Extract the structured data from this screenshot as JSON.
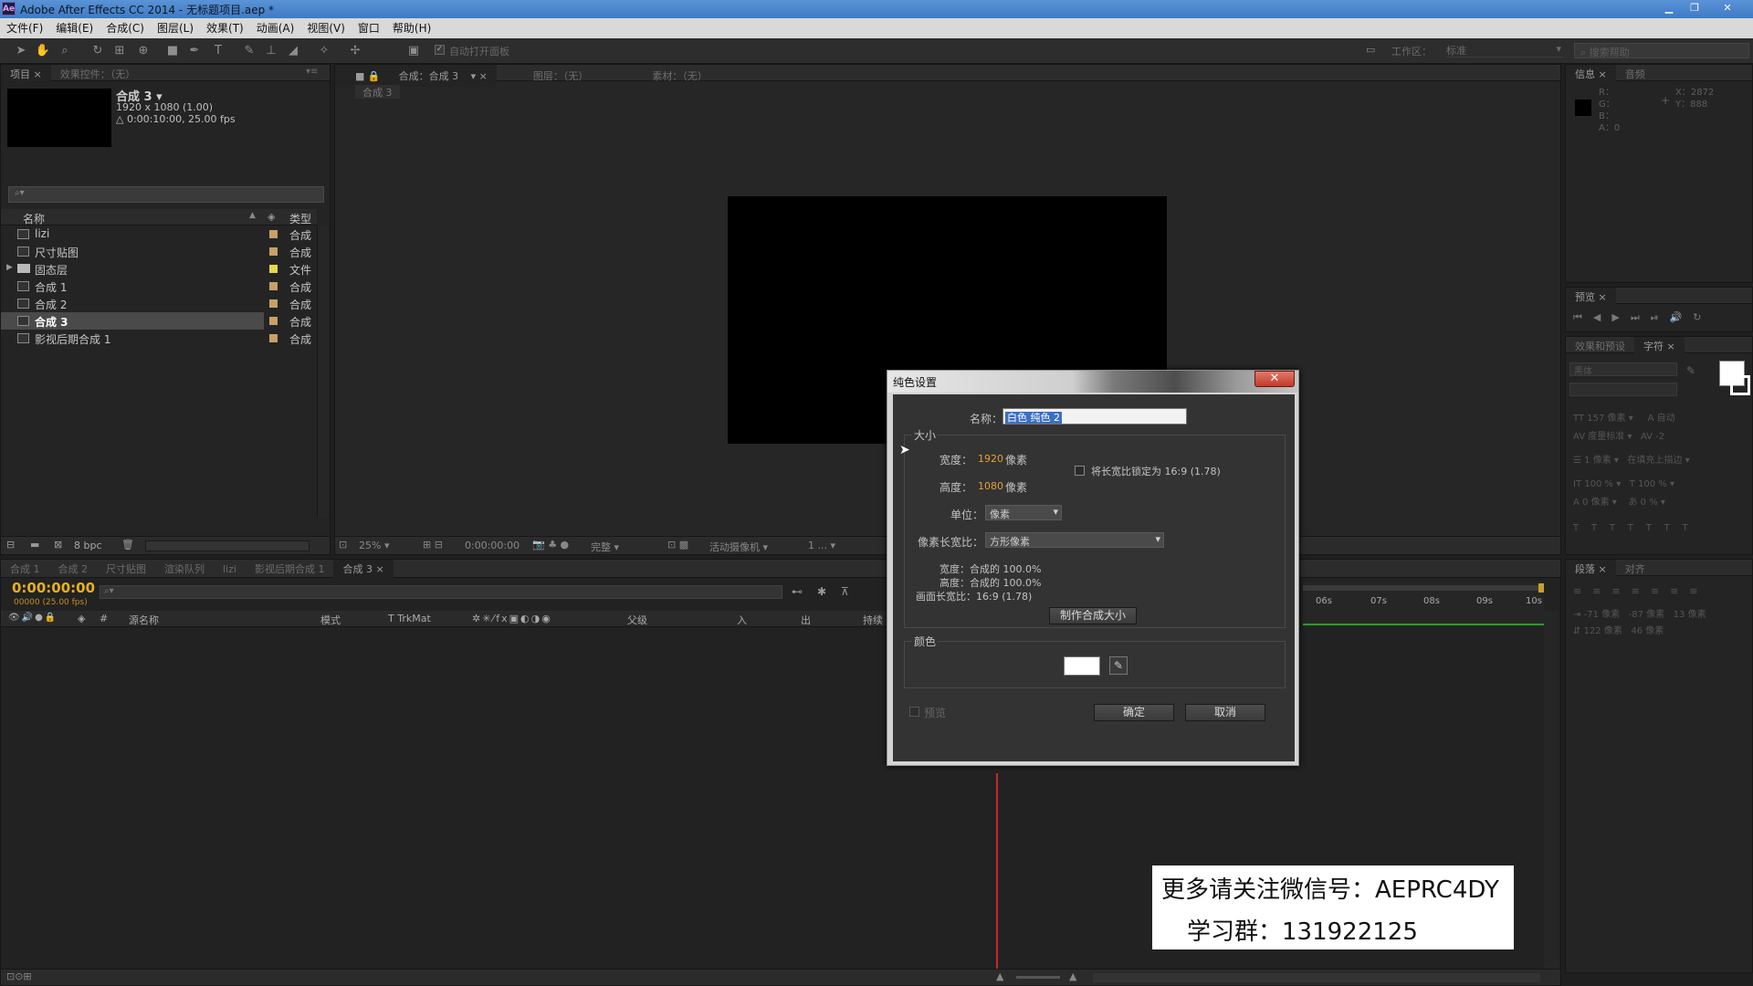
{
  "window": {
    "app_icon": "Ae",
    "title": "Adobe After Effects CC 2014 - 无标题项目.aep *"
  },
  "menu": [
    "文件(F)",
    "编辑(E)",
    "合成(C)",
    "图层(L)",
    "效果(T)",
    "动画(A)",
    "视图(V)",
    "窗口",
    "帮助(H)"
  ],
  "toolbar": {
    "auto_open_panel": "自动打开面板",
    "workspace_label": "工作区：",
    "workspace_value": "标准",
    "search_placeholder": "搜索帮助"
  },
  "project_panel": {
    "tabs": [
      "项目 ×",
      "效果控件：（无）"
    ],
    "selected_name": "合成 3 ▾",
    "selected_res": "1920 x 1080 (1.00)",
    "selected_dur": "△ 0:00:10:00, 25.00 fps",
    "col_name": "名称",
    "col_type": "类型",
    "items": [
      {
        "name": "lizi",
        "type": "合成",
        "kind": "comp",
        "label": "#c9a066"
      },
      {
        "name": "尺寸贴图",
        "type": "合成",
        "kind": "comp",
        "label": "#c9a066"
      },
      {
        "name": "固态层",
        "type": "文件",
        "kind": "folder",
        "label": "#e8d84a"
      },
      {
        "name": "合成 1",
        "type": "合成",
        "kind": "comp",
        "label": "#c9a066"
      },
      {
        "name": "合成 2",
        "type": "合成",
        "kind": "comp",
        "label": "#c9a066"
      },
      {
        "name": "合成 3",
        "type": "合成",
        "kind": "comp",
        "label": "#c9a066"
      },
      {
        "name": "影视后期合成 1",
        "type": "合成",
        "kind": "comp",
        "label": "#c9a066"
      }
    ],
    "bpc": "8 bpc"
  },
  "comp_panel": {
    "tabs": [
      "合成：合成 3",
      "图层：（无）",
      "素材：（无）"
    ],
    "sub_tab": "合成 3",
    "zoom": "25%",
    "timecode": "0:00:00:00",
    "quality": "完整",
    "camera": "活动摄像机",
    "views": "1 ..."
  },
  "info_panel": {
    "tabs": [
      "信息 ×",
      "音频"
    ],
    "r": "R：",
    "g": "G：",
    "b": "B：",
    "a": "A：0",
    "x": "X：2872",
    "y": "Y：888"
  },
  "preview_panel": {
    "tab": "预览 ×"
  },
  "char_panel": {
    "tabs": [
      "效果和预设",
      "字符 ×"
    ],
    "font": "黑体",
    "size": "157 像素",
    "leading": "自动",
    "kerning": "度量标准",
    "tracking": "-2",
    "stroke": "1 像素",
    "stroke_mode": "在填充上描边",
    "vscale": "100 %",
    "hscale": "100 %",
    "baseline": "0 像素",
    "tsume": "0 %"
  },
  "para_panel": {
    "tabs": [
      "段落 ×",
      "对齐"
    ],
    "indent1": "-71 像素",
    "indent2": "-87 像素",
    "indent3": "13 像素",
    "space1": "122 像素",
    "space2": "46 像素"
  },
  "timeline": {
    "tabs": [
      "合成 1",
      "合成 2",
      "尺寸贴图",
      "渲染队列",
      "lizi",
      "影视后期合成 1",
      "合成 3 ×"
    ],
    "timecode": "0:00:00:00",
    "fps": "00000 (25.00 fps)",
    "col_source": "源名称",
    "col_mode": "模式",
    "col_trkmat": "T  TrkMat",
    "col_parent": "父级",
    "col_in": "入",
    "col_out": "出",
    "col_dur": "持续",
    "ruler": [
      "06s",
      "07s",
      "08s",
      "09s",
      "10s"
    ]
  },
  "dialog": {
    "title": "纯色设置",
    "name_label": "名称：",
    "name_value": "白色 纯色 2",
    "size_group": "大小",
    "width_label": "宽度：",
    "width_value": "1920",
    "height_label": "高度：",
    "height_value": "1080",
    "px": "像素",
    "lock_aspect": "将长宽比锁定为 16:9 (1.78)",
    "units_label": "单位：",
    "units_value": "像素",
    "par_label": "像素长宽比：",
    "par_value": "方形像素",
    "info_width": "宽度：合成的 100.0%",
    "info_height": "高度：合成的 100.0%",
    "info_frame": "画面长宽比：16:9 (1.78)",
    "make_comp_size": "制作合成大小",
    "color_group": "颜色",
    "color_value": "#ffffff",
    "preview": "预览",
    "ok": "确定",
    "cancel": "取消"
  },
  "watermark": {
    "line1": "更多请关注微信号：AEPRC4DY",
    "line2": "学习群：131922125"
  }
}
